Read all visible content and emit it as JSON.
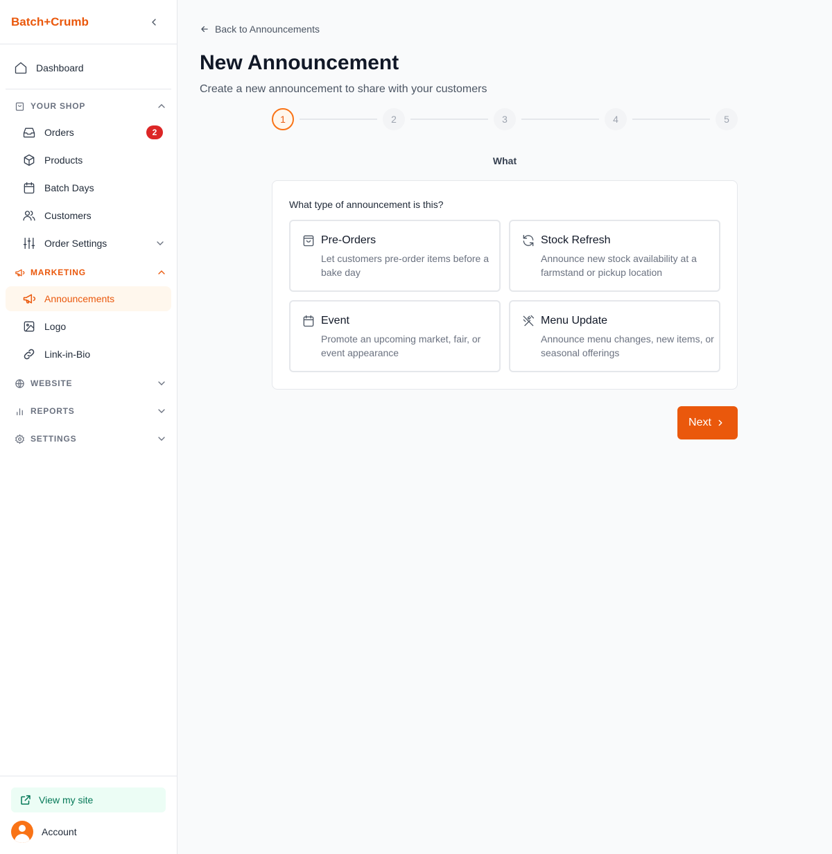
{
  "brand": {
    "name": "Batch+Crumb",
    "color": "#ea580c"
  },
  "sidebar": {
    "dashboard": "Dashboard",
    "shop_section": "YOUR SHOP",
    "orders": "Orders",
    "orders_badge": "2",
    "products": "Products",
    "batch_days": "Batch Days",
    "customers": "Customers",
    "order_settings": "Order Settings",
    "marketing_section": "MARKETING",
    "announcements": "Announcements",
    "logo": "Logo",
    "link_in_bio": "Link-in-Bio",
    "website_section": "WEBSITE",
    "reports_section": "REPORTS",
    "settings_section": "SETTINGS",
    "view_site": "View my site",
    "account": "Account"
  },
  "main": {
    "back_link": "Back to Announcements",
    "title": "New Announcement",
    "subtitle": "Create a new announcement to share with your customers",
    "steps": [
      "1",
      "2",
      "3",
      "4",
      "5"
    ],
    "active_step": 1,
    "step_label": "What",
    "question": "What type of announcement is this?",
    "options": [
      {
        "icon": "shopping-bag-icon",
        "title": "Pre-Orders",
        "description": "Let customers pre-order items before a bake day"
      },
      {
        "icon": "refresh-icon",
        "title": "Stock Refresh",
        "description": "Announce new stock availability at a farmstand or pickup location"
      },
      {
        "icon": "calendar-icon",
        "title": "Event",
        "description": "Promote an upcoming market, fair, or event appearance"
      },
      {
        "icon": "utensils-crossed-icon",
        "title": "Menu Update",
        "description": "Announce menu changes, new items, or seasonal offerings"
      }
    ],
    "next_label": "Next"
  },
  "colors": {
    "accent": "#ea580c",
    "accent_light": "#fff7ed",
    "badge": "#dc2626",
    "success_bg": "#ecfdf5",
    "success_text": "#047857"
  }
}
